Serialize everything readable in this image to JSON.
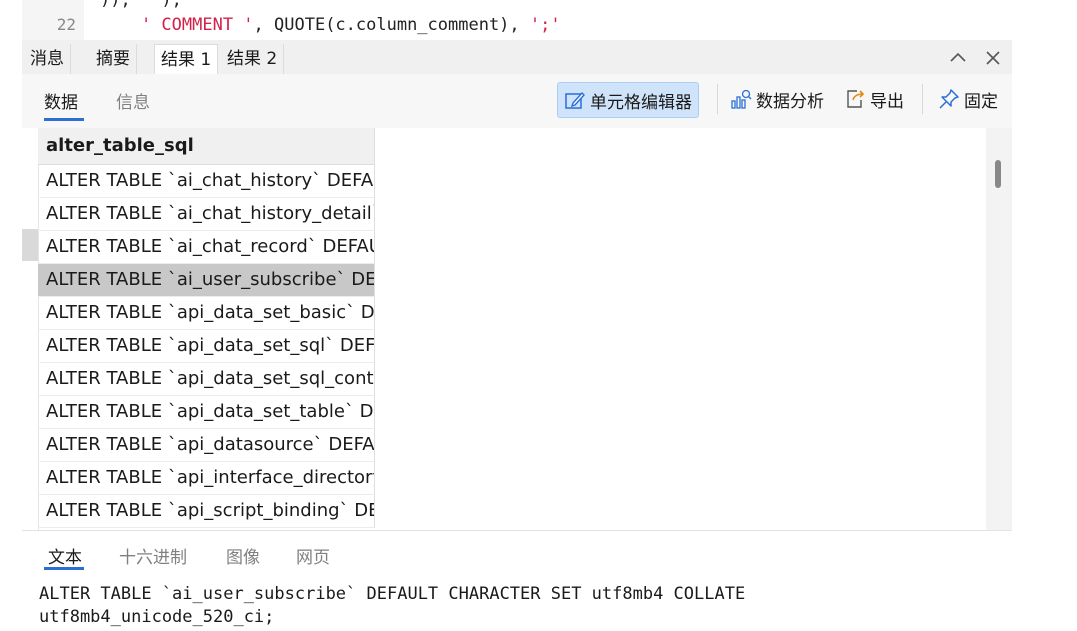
{
  "editor": {
    "line_number": "22",
    "top_fragment": ")), '');",
    "code_indent": "    ",
    "string_comment": "' COMMENT '",
    "code_mid": ", QUOTE(c.column_comment), ",
    "string_semicolon": "';'"
  },
  "result_tabs": [
    "消息",
    "摘要",
    "结果 1",
    "结果 2"
  ],
  "active_result_tab": "结果 1",
  "toolbar": {
    "subtabs": [
      "数据",
      "信息"
    ],
    "active_subtab": "数据",
    "cell_editor_label": "单元格编辑器",
    "data_analysis_label": "数据分析",
    "export_label": "导出",
    "pin_label": "固定"
  },
  "grid": {
    "column_header": "alter_table_sql",
    "selected_row_index": 3,
    "rows": [
      "ALTER TABLE `ai_chat_history` DEFAUl",
      "ALTER TABLE `ai_chat_history_detail` [",
      "ALTER TABLE `ai_chat_record` DEFAUL",
      "ALTER TABLE `ai_user_subscribe` DEFA",
      "ALTER TABLE `api_data_set_basic` DEF",
      "ALTER TABLE `api_data_set_sql` DEFAU",
      "ALTER TABLE `api_data_set_sql_contex",
      "ALTER TABLE `api_data_set_table` DEF",
      "ALTER TABLE `api_datasource` DEFAU",
      "ALTER TABLE `api_interface_directory`",
      "ALTER TABLE `api_script_binding` DEF"
    ]
  },
  "bottom_panel": {
    "tabs": [
      "文本",
      "十六进制",
      "图像",
      "网页"
    ],
    "active_tab": "文本",
    "text": "ALTER TABLE `ai_user_subscribe` DEFAULT CHARACTER SET utf8mb4 COLLATE\nutf8mb4_unicode_520_ci;"
  },
  "colors": {
    "accent": "#2a6fd6",
    "string": "#d1224a",
    "selected_row": "#c8c8c8",
    "active_button": "#cfe4fb"
  },
  "icons": [
    "minimize-chevron-icon",
    "close-icon",
    "cell-editor-icon",
    "data-analysis-icon",
    "export-icon",
    "pin-icon"
  ]
}
